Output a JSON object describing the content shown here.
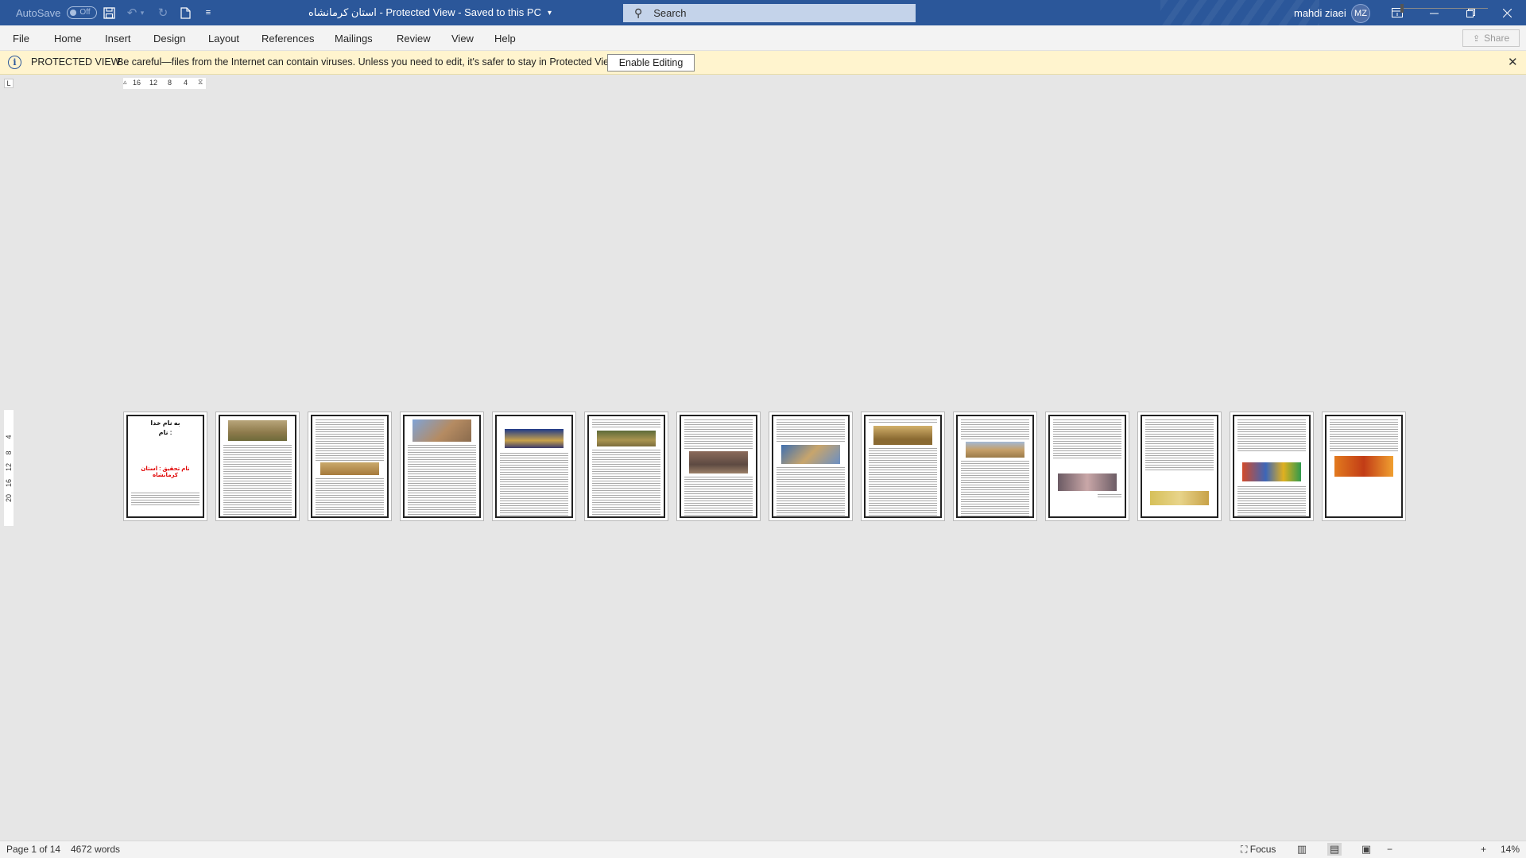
{
  "titlebar": {
    "autosave_label": "AutoSave",
    "autosave_state": "Off",
    "doc_title": "استان کرمانشاه  -  Protected View  -  Saved to this PC",
    "search_placeholder": "Search",
    "user_name": "mahdi ziaei",
    "user_initials": "MZ"
  },
  "ribbon": {
    "tabs": [
      "File",
      "Home",
      "Insert",
      "Design",
      "Layout",
      "References",
      "Mailings",
      "Review",
      "View",
      "Help"
    ],
    "share_label": "Share"
  },
  "message_bar": {
    "label": "PROTECTED VIEW",
    "text": "Be careful—files from the Internet can contain viruses. Unless you need to edit, it's safer to stay in Protected View.",
    "button": "Enable Editing"
  },
  "ruler": {
    "horizontal_ticks": [
      "16",
      "12",
      "8",
      "4"
    ],
    "vertical_ticks": [
      "4",
      "8",
      "12",
      "16",
      "20"
    ],
    "tab_selector": "L"
  },
  "pages": {
    "count": 14,
    "cover_lines": [
      "به نام خدا",
      "نام :",
      "نام تحقیق : استان کرمانشاه"
    ]
  },
  "statusbar": {
    "page_info": "Page 1 of 14",
    "word_count": "4672 words",
    "focus_label": "Focus",
    "zoom_level": "14%"
  },
  "colors": {
    "titlebar": "#2b579a",
    "message_bar": "#fff4ce",
    "cover_title_red": "#e00000"
  }
}
